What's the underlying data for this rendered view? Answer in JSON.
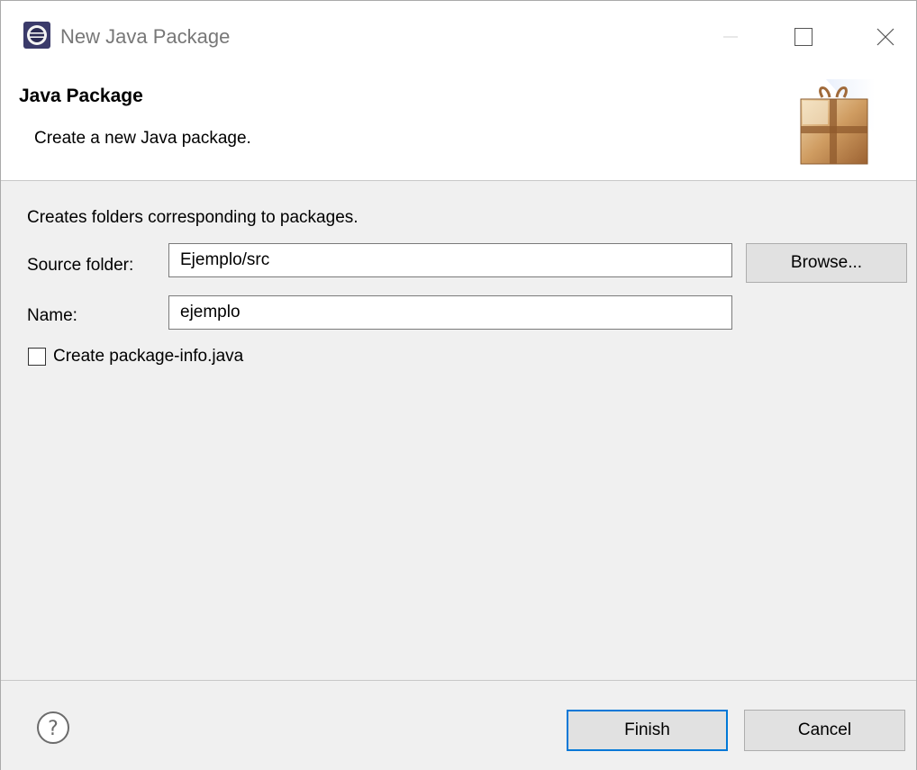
{
  "window": {
    "title": "New Java Package",
    "icon": "eclipse-icon"
  },
  "banner": {
    "title": "Java Package",
    "description": "Create a new Java package.",
    "image": "package-gift-icon"
  },
  "form": {
    "description": "Creates folders corresponding to packages.",
    "source_folder_label": "Source folder:",
    "source_folder_value": "Ejemplo/src",
    "browse_label": "Browse...",
    "name_label": "Name:",
    "name_value": "ejemplo",
    "package_info_label": "Create package-info.java",
    "package_info_checked": false
  },
  "footer": {
    "help_icon": "help-icon",
    "finish_label": "Finish",
    "cancel_label": "Cancel"
  },
  "colors": {
    "default_button_border": "#0078d7",
    "dialog_background": "#f0f0f0"
  }
}
